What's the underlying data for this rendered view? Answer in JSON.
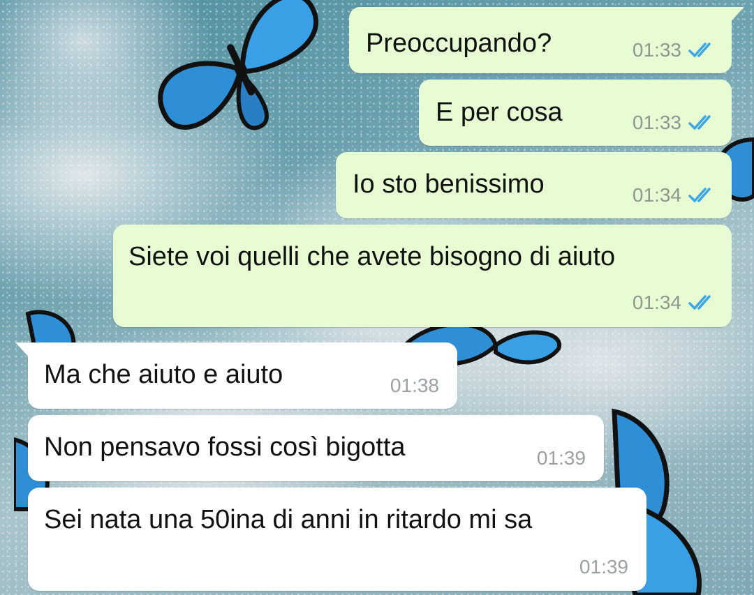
{
  "chat": {
    "messages": [
      {
        "direction": "outgoing",
        "text": "Preoccupando?",
        "time": "01:33",
        "status": "read"
      },
      {
        "direction": "outgoing",
        "text": "E per cosa",
        "time": "01:33",
        "status": "read"
      },
      {
        "direction": "outgoing",
        "text": "Io sto benissimo",
        "time": "01:34",
        "status": "read"
      },
      {
        "direction": "outgoing",
        "text": "Siete voi quelli che avete bisogno di aiuto",
        "time": "01:34",
        "status": "read"
      },
      {
        "direction": "incoming",
        "text": "Ma che aiuto e aiuto",
        "time": "01:38"
      },
      {
        "direction": "incoming",
        "text": "Non pensavo fossi così bigotta",
        "time": "01:39"
      },
      {
        "direction": "incoming",
        "text": "Sei nata una 50ina di anni in ritardo mi sa",
        "time": "01:39"
      }
    ]
  },
  "theme": {
    "outgoing_bubble": "#e8fcd3",
    "incoming_bubble": "#ffffff",
    "read_tick": "#3aa6e6",
    "timestamp": "#8d968f",
    "wallpaper": "blue butterflies on glitter sky",
    "icons": [
      "double-check-icon",
      "butterfly-icon"
    ]
  }
}
